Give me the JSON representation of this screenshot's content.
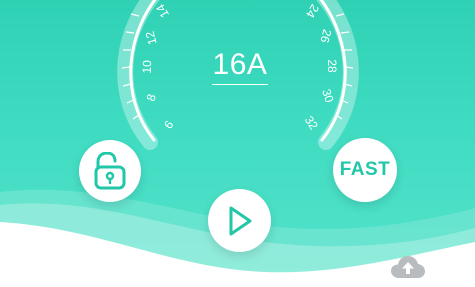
{
  "current": {
    "value": "16A"
  },
  "gauge": {
    "left_ticks": [
      "6",
      "8",
      "10",
      "12",
      "14"
    ],
    "right_ticks": [
      "24",
      "26",
      "28",
      "30",
      "32"
    ]
  },
  "buttons": {
    "lock": {
      "icon": "unlock-icon"
    },
    "fast": {
      "label": "FAST"
    },
    "play": {
      "icon": "play-icon"
    },
    "cloud": {
      "icon": "cloud-upload-icon"
    }
  },
  "colors": {
    "accent": "#2fd1b4",
    "icon_teal": "#22c7a8",
    "cloud_gray": "#b9bcbf"
  }
}
